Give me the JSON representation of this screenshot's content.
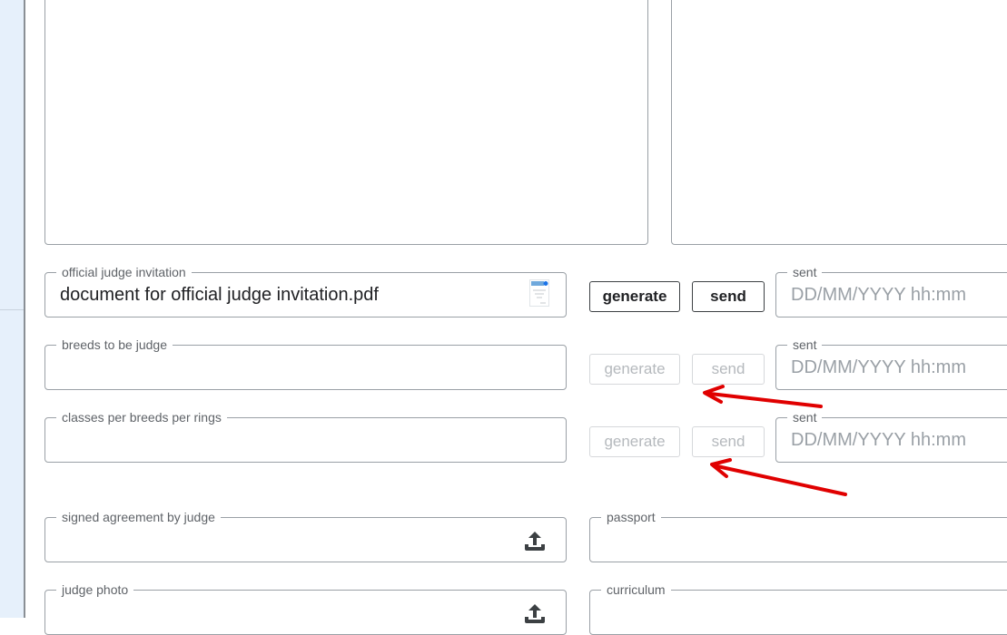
{
  "invitation": {
    "label": "official judge invitation",
    "value": "document for official judge invitation.pdf",
    "generate_label": "generate",
    "send_label": "send",
    "sent_label": "sent",
    "sent_placeholder": "DD/MM/YYYY hh:mm"
  },
  "breeds": {
    "label": "breeds to be judge",
    "generate_label": "generate",
    "send_label": "send",
    "sent_label": "sent",
    "sent_placeholder": "DD/MM/YYYY hh:mm"
  },
  "classes": {
    "label": "classes per breeds per rings",
    "generate_label": "generate",
    "send_label": "send",
    "sent_label": "sent",
    "sent_placeholder": "DD/MM/YYYY hh:mm"
  },
  "signed_agreement": {
    "label": "signed agreement by judge"
  },
  "passport": {
    "label": "passport"
  },
  "judge_photo": {
    "label": "judge photo"
  },
  "curriculum": {
    "label": "curriculum"
  },
  "icons": {
    "upload": "upload-icon",
    "pdf_preview": "document-thumbnail-icon"
  },
  "colors": {
    "annotation_arrow": "#e00000",
    "border": "#9aa0a6",
    "disabled_text": "#b5b9bd"
  }
}
